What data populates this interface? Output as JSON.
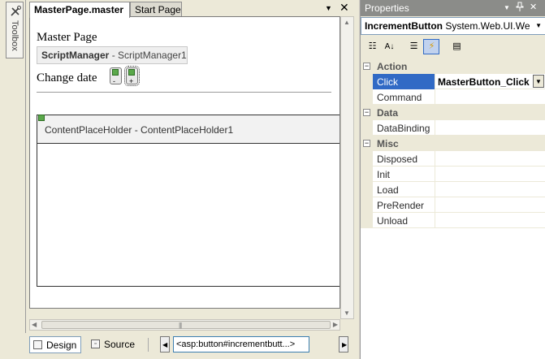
{
  "toolbox": {
    "label": "Toolbox",
    "icon": "toolbox-icon"
  },
  "tabs": [
    {
      "label": "MasterPage.master",
      "active": true
    },
    {
      "label": "Start Page",
      "active": false
    }
  ],
  "doc_controls": {
    "dropdown": "▼",
    "close": "✕"
  },
  "design": {
    "heading": "Master Page",
    "scriptmanager": {
      "type": "ScriptManager",
      "id": " - ScriptManager1"
    },
    "change_date_label": "Change date",
    "button_symbols": {
      "decrement": "-",
      "increment": "+"
    },
    "content_placeholder": "ContentPlaceHolder - ContentPlaceHolder1"
  },
  "bottom": {
    "design_label": "Design",
    "source_label": "Source",
    "tag_crumb": "<asp:button#incrementbutt...>",
    "nav_left": "◀",
    "nav_right": "▶"
  },
  "properties": {
    "title": "Properties",
    "title_controls": {
      "dropdown": "▼",
      "pin": "📌",
      "close": "✕"
    },
    "object_name": "IncrementButton",
    "object_type": " System.Web.UI.We",
    "categories": [
      {
        "name": "Action",
        "rows": [
          {
            "name": "Click",
            "value": "MasterButton_Click",
            "selected": true
          },
          {
            "name": "Command",
            "value": ""
          }
        ]
      },
      {
        "name": "Data",
        "rows": [
          {
            "name": "DataBinding",
            "value": ""
          }
        ]
      },
      {
        "name": "Misc",
        "rows": [
          {
            "name": "Disposed",
            "value": ""
          },
          {
            "name": "Init",
            "value": ""
          },
          {
            "name": "Load",
            "value": ""
          },
          {
            "name": "PreRender",
            "value": ""
          },
          {
            "name": "Unload",
            "value": ""
          }
        ]
      }
    ],
    "collapse_symbol": "−"
  },
  "colors": {
    "selection": "#316ac5",
    "panel": "#ece9d8",
    "title_bar": "#8b8c89"
  }
}
